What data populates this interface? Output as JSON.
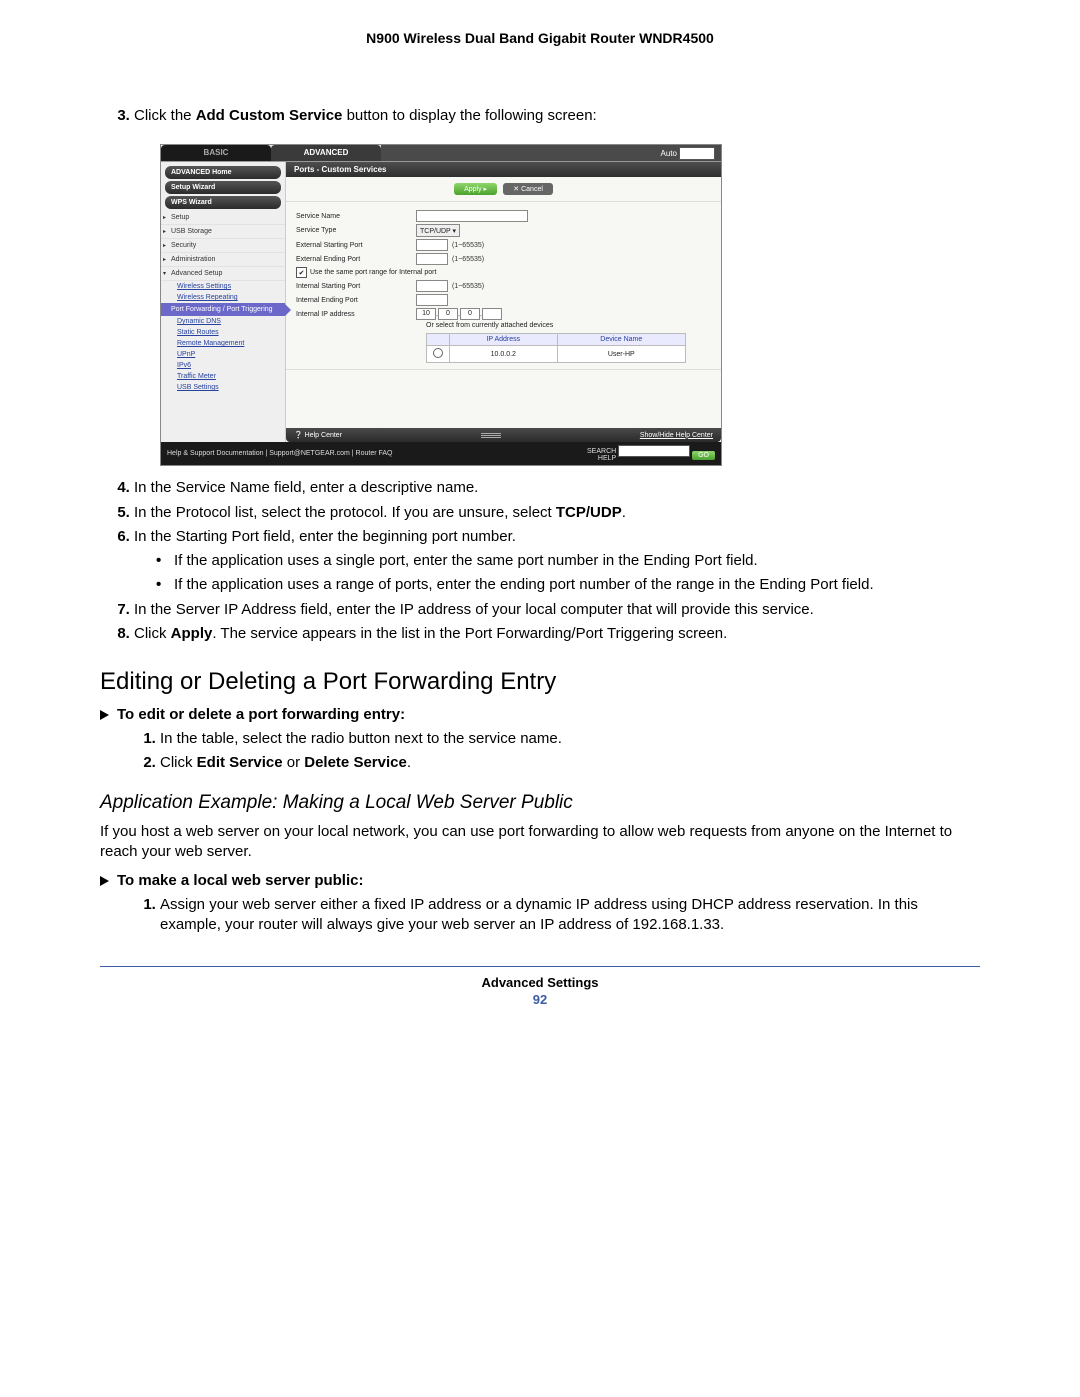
{
  "header": {
    "title": "N900 Wireless Dual Band Gigabit Router WNDR4500"
  },
  "step3": {
    "pre": "Click the ",
    "bold": "Add Custom Service",
    "post": " button to display the following screen:"
  },
  "shot": {
    "tabs": {
      "basic": "BASIC",
      "advanced": "ADVANCED",
      "auto_label": "Auto"
    },
    "sidebar": {
      "btn_home": "ADVANCED Home",
      "btn_setup": "Setup Wizard",
      "btn_wps": "WPS Wizard",
      "items": {
        "setup": "Setup",
        "usb": "USB Storage",
        "security": "Security",
        "admin": "Administration",
        "advsetup": "Advanced Setup"
      },
      "subs": {
        "wireless_settings": "Wireless Settings",
        "wireless_repeating": "Wireless Repeating",
        "port_fwd": "Port Forwarding / Port Triggering",
        "dyndns": "Dynamic DNS",
        "static_routes": "Static Routes",
        "remote_mgmt": "Remote Management",
        "upnp": "UPnP",
        "ipv6": "IPv6",
        "traffic": "Traffic Meter",
        "usb_settings": "USB Settings"
      }
    },
    "content": {
      "title": "Ports - Custom Services",
      "apply": "Apply ▸",
      "cancel": "✕ Cancel",
      "labels": {
        "service_name": "Service Name",
        "service_type": "Service Type",
        "ext_start": "External Starting Port",
        "ext_end": "External Ending Port",
        "same_range": "Use the same port range for Internal port",
        "int_start": "Internal Starting Port",
        "int_end": "Internal Ending Port",
        "int_ip": "Internal IP address"
      },
      "values": {
        "service_type": "TCP/UDP ▾",
        "port_hint": "(1~65535)",
        "ip1": "10",
        "ip2": "0",
        "ip3": "0",
        "ip4": ""
      },
      "dev_caption": "Or select from currently attached devices",
      "dev_headers": {
        "ip": "IP Address",
        "name": "Device Name"
      },
      "dev_row": {
        "ip": "10.0.0.2",
        "name": "User-HP"
      },
      "helpcenter": "Help Center",
      "showhide": "Show/Hide Help Center"
    },
    "footer": {
      "left": "Help & Support  Documentation | Support@NETGEAR.com | Router FAQ",
      "search_label1": "SEARCH",
      "search_label2": "HELP",
      "go": "GO"
    }
  },
  "steps": {
    "s4": "In the Service Name field, enter a descriptive name.",
    "s5_pre": "In the Protocol list, select the protocol. If you are unsure, select ",
    "s5_bold": "TCP/UDP",
    "s5_post": ".",
    "s6": "In the Starting Port field, enter the beginning port number.",
    "s6_b1": "If the application uses a single port, enter the same port number in the Ending Port field.",
    "s6_b2": "If the application uses a range of ports, enter the ending port number of the range in the Ending Port field.",
    "s7": "In the Server IP Address field, enter the IP address of your local computer that will provide this service.",
    "s8_pre": "Click ",
    "s8_bold": "Apply",
    "s8_post": ". The service appears in the list in the Port Forwarding/Port Triggering screen."
  },
  "section2": {
    "heading": "Editing or Deleting a Port Forwarding Entry",
    "proc_head": "To edit or delete a port forwarding entry:",
    "s1": "In the table, select the radio button next to the service name.",
    "s2_pre": "Click ",
    "s2_b1": "Edit Service",
    "s2_mid": " or ",
    "s2_b2": "Delete Service",
    "s2_post": "."
  },
  "section3": {
    "heading": "Application Example: Making a Local Web Server Public",
    "body": "If you host a web server on your local network, you can use port forwarding to allow web requests from anyone on the Internet to reach your web server.",
    "proc_head": "To make a local web server public:",
    "s1": "Assign your web server either a fixed IP address or a dynamic IP address using DHCP address reservation. In this example, your router will always give your web server an IP address of 192.168.1.33."
  },
  "footer": {
    "label": "Advanced Settings",
    "page": "92"
  }
}
